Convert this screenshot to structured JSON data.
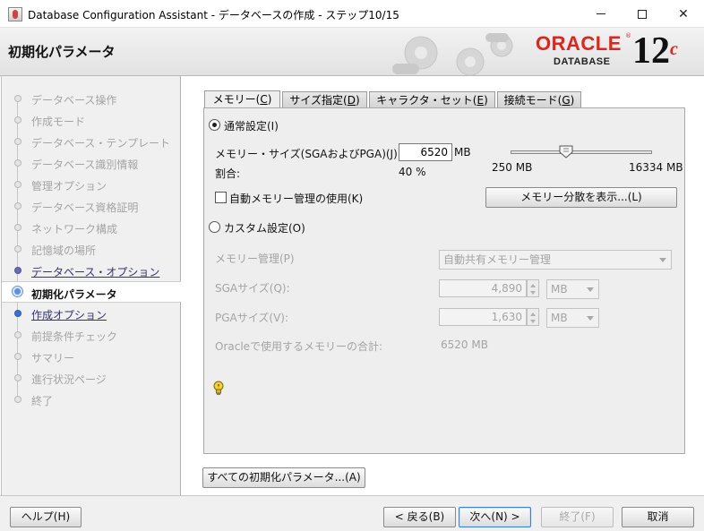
{
  "window": {
    "title": "Database Configuration Assistant - データベースの作成 - ステップ10/15",
    "controls": {
      "minimize": "—",
      "maximize": "☐",
      "close": "✕"
    }
  },
  "header": {
    "step_title": "初期化パラメータ",
    "brand": {
      "oracle": "ORACLE",
      "database": "DATABASE",
      "version": "12",
      "version_suffix": "c",
      "reg": "®"
    }
  },
  "sidebar": {
    "items": [
      {
        "label": "データベース操作",
        "state": "disabled"
      },
      {
        "label": "作成モード",
        "state": "disabled"
      },
      {
        "label": "データベース・テンプレート",
        "state": "disabled"
      },
      {
        "label": "データベース識別情報",
        "state": "disabled"
      },
      {
        "label": "管理オプション",
        "state": "disabled"
      },
      {
        "label": "データベース資格証明",
        "state": "disabled"
      },
      {
        "label": "ネットワーク構成",
        "state": "disabled"
      },
      {
        "label": "記憶域の場所",
        "state": "disabled"
      },
      {
        "label": "データベース・オプション",
        "state": "link"
      },
      {
        "label": "初期化パラメータ",
        "state": "current"
      },
      {
        "label": "作成オプション",
        "state": "link"
      },
      {
        "label": "前提条件チェック",
        "state": "disabled"
      },
      {
        "label": "サマリー",
        "state": "disabled"
      },
      {
        "label": "進行状況ページ",
        "state": "disabled"
      },
      {
        "label": "終了",
        "state": "disabled"
      }
    ]
  },
  "tabs": [
    {
      "label": "メモリー",
      "mnemonic": "C",
      "active": true
    },
    {
      "label": "サイズ指定",
      "mnemonic": "D",
      "active": false
    },
    {
      "label": "キャラクタ・セット",
      "mnemonic": "E",
      "active": false
    },
    {
      "label": "接続モード",
      "mnemonic": "G",
      "active": false
    }
  ],
  "memory": {
    "typical": {
      "radio_label": "通常設定(I)",
      "selected": true,
      "memory_size_label": "メモリー・サイズ(SGAおよびPGA)(J):",
      "memory_size_value": "6520",
      "memory_size_unit": "MB",
      "percentage_label": "割合:",
      "percentage_value": "40 %",
      "slider_min": "250 MB",
      "slider_max": "16334 MB",
      "slider_fraction": 0.39,
      "amm_checkbox_label": "自動メモリー管理の使用(K)",
      "amm_checked": false,
      "show_distribution_button": "メモリー分散を表示...(L)"
    },
    "custom": {
      "radio_label": "カスタム設定(O)",
      "selected": false,
      "memory_management_label": "メモリー管理(P)",
      "memory_management_value": "自動共有メモリー管理",
      "sga_label": "SGAサイズ(Q):",
      "sga_value": "4,890",
      "sga_unit": "MB",
      "pga_label": "PGAサイズ(V):",
      "pga_value": "1,630",
      "pga_unit": "MB",
      "total_label": "Oracleで使用するメモリーの合計:",
      "total_value": "6520 MB"
    }
  },
  "all_params_button": "すべての初期化パラメータ...(A)",
  "footer": {
    "help": "ヘルプ(H)",
    "back": "< 戻る(B)",
    "next": "次へ(N) >",
    "finish": "終了(F)",
    "cancel": "取消"
  },
  "colors": {
    "oracle_red": "#e2231a",
    "link_text": "#34346e",
    "disabled_text": "#a4a4a4",
    "panel_bg": "#eeeeee"
  }
}
